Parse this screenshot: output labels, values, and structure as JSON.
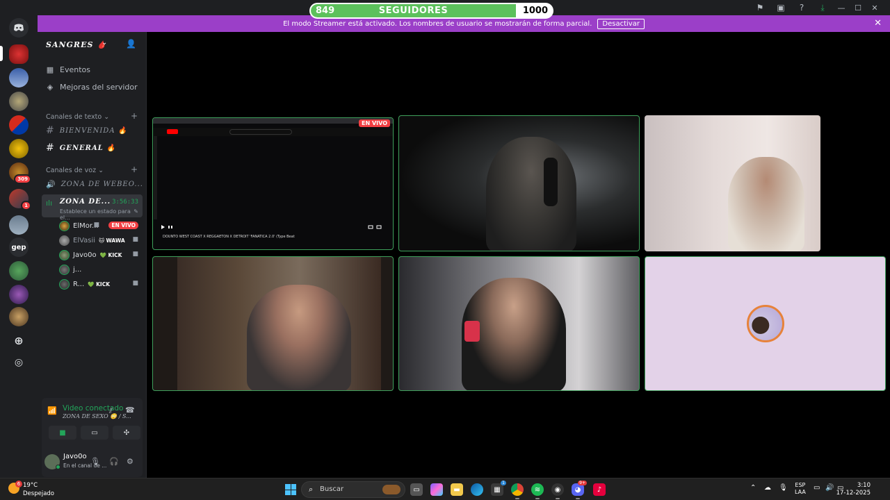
{
  "followers": {
    "current": "849",
    "label": "SEGUIDORES",
    "goal": "1000",
    "progress": 0.849
  },
  "banner": {
    "message": "El modo Streamer está activado. Los nombres de usuario se mostrarán de forma parcial.",
    "button": "Desactivar"
  },
  "rail": {
    "badges": {
      "server7": "309",
      "server8": "1"
    },
    "text_server": "gep"
  },
  "server": {
    "name": "SANGRES 🩸"
  },
  "nav": {
    "events": "Eventos",
    "boosts": "Mejoras del servidor"
  },
  "categories": {
    "text": "Canales de texto",
    "voice": "Canales de voz"
  },
  "text_channels": [
    {
      "name": "BIENVENIDA 🔥"
    },
    {
      "name": "GENERAL 🔥"
    }
  ],
  "voice_channels": {
    "first": "ZONA DE WEBEO...",
    "active": {
      "name": "ZONA DE...",
      "time": "3:56:33",
      "status": "Establece un estado para el..."
    }
  },
  "members": [
    {
      "name": "ElMor...",
      "tag": "EN VIVO"
    },
    {
      "name": "ElVasii",
      "tag": "🐱 WAWA"
    },
    {
      "name": "Javo0o",
      "tag": "💚 KICK"
    },
    {
      "name": "j...",
      "tag": ""
    },
    {
      "name": "R...",
      "tag": "💚 KICK"
    }
  ],
  "voice_panel": {
    "status": "Video conectado",
    "channel": "ZONA DE SEXO 😳 / S..."
  },
  "user": {
    "name": "Javo0o",
    "status": "En el canal de ..."
  },
  "stream": {
    "live_badge": "EN VIVO",
    "video_title": "DOUNTO WEST COAST X REGGAETON X DETROIT 'FANATICA 2.0' (Type Beat"
  },
  "taskbar": {
    "weather_temp": "19°C",
    "weather_desc": "Despejado",
    "weather_badge": "6",
    "search": "Buscar",
    "lang_line1": "ESP",
    "lang_line2": "LAA",
    "time": "3:10",
    "date": "17-12-2025",
    "store_badge": "1",
    "discord_badge": "9+"
  }
}
